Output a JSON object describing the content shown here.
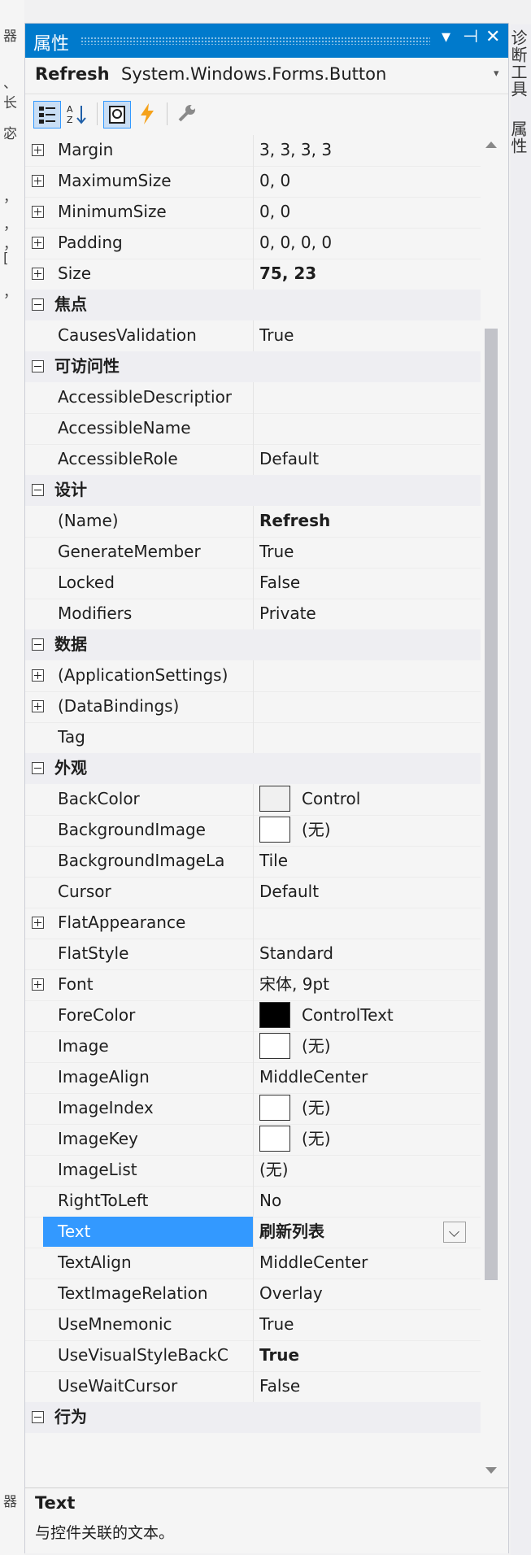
{
  "left_fragments": [
    "器",
    "、",
    "长",
    "宓",
    "，",
    "，",
    "，",
    "[",
    "，",
    "器"
  ],
  "right_tabs": [
    "诊断工具",
    "属性"
  ],
  "window": {
    "title": "属性",
    "dropdown_glyph": "▾",
    "pin_glyph": "⊣",
    "close_glyph": "✕"
  },
  "object": {
    "name": "Refresh",
    "type": "System.Windows.Forms.Button",
    "caret": "▾"
  },
  "toolbar": {
    "categorized_icon": "categorized-icon",
    "alphabetical_icon": "alphabetical-icon",
    "properties_icon": "properties-icon",
    "events_icon": "events-icon",
    "property_pages_icon": "property-pages-icon"
  },
  "rows": [
    {
      "kind": "prop",
      "expand": "plus",
      "name": "Margin",
      "value": "3, 3, 3, 3"
    },
    {
      "kind": "prop",
      "expand": "plus",
      "name": "MaximumSize",
      "value": "0, 0"
    },
    {
      "kind": "prop",
      "expand": "plus",
      "name": "MinimumSize",
      "value": "0, 0"
    },
    {
      "kind": "prop",
      "expand": "plus",
      "name": "Padding",
      "value": "0, 0, 0, 0"
    },
    {
      "kind": "prop",
      "expand": "plus",
      "name": "Size",
      "value": "75, 23",
      "bold": true
    },
    {
      "kind": "cat",
      "name": "焦点"
    },
    {
      "kind": "prop",
      "name": "CausesValidation",
      "value": "True"
    },
    {
      "kind": "cat",
      "name": "可访问性"
    },
    {
      "kind": "prop",
      "name": "AccessibleDescriptior",
      "value": ""
    },
    {
      "kind": "prop",
      "name": "AccessibleName",
      "value": ""
    },
    {
      "kind": "prop",
      "name": "AccessibleRole",
      "value": "Default"
    },
    {
      "kind": "cat",
      "name": "设计"
    },
    {
      "kind": "prop",
      "name": "(Name)",
      "value": "Refresh",
      "bold": true
    },
    {
      "kind": "prop",
      "name": "GenerateMember",
      "value": "True"
    },
    {
      "kind": "prop",
      "name": "Locked",
      "value": "False"
    },
    {
      "kind": "prop",
      "name": "Modifiers",
      "value": "Private"
    },
    {
      "kind": "cat",
      "name": "数据"
    },
    {
      "kind": "prop",
      "expand": "plus",
      "name": "(ApplicationSettings)",
      "value": ""
    },
    {
      "kind": "prop",
      "expand": "plus",
      "name": "(DataBindings)",
      "value": ""
    },
    {
      "kind": "prop",
      "name": "Tag",
      "value": ""
    },
    {
      "kind": "cat",
      "name": "外观"
    },
    {
      "kind": "prop",
      "name": "BackColor",
      "value": "Control",
      "swatch": "control"
    },
    {
      "kind": "prop",
      "name": "BackgroundImage",
      "value": "(无)",
      "swatch": "none"
    },
    {
      "kind": "prop",
      "name": "BackgroundImageLa",
      "value": "Tile"
    },
    {
      "kind": "prop",
      "name": "Cursor",
      "value": "Default"
    },
    {
      "kind": "prop",
      "expand": "plus",
      "name": "FlatAppearance",
      "value": ""
    },
    {
      "kind": "prop",
      "name": "FlatStyle",
      "value": "Standard"
    },
    {
      "kind": "prop",
      "expand": "plus",
      "name": "Font",
      "value": "宋体, 9pt"
    },
    {
      "kind": "prop",
      "name": "ForeColor",
      "value": "ControlText",
      "swatch": "black"
    },
    {
      "kind": "prop",
      "name": "Image",
      "value": "(无)",
      "swatch": "none"
    },
    {
      "kind": "prop",
      "name": "ImageAlign",
      "value": "MiddleCenter"
    },
    {
      "kind": "prop",
      "name": "ImageIndex",
      "value": "(无)",
      "swatch": "none"
    },
    {
      "kind": "prop",
      "name": "ImageKey",
      "value": "(无)",
      "swatch": "none"
    },
    {
      "kind": "prop",
      "name": "ImageList",
      "value": "(无)"
    },
    {
      "kind": "prop",
      "name": "RightToLeft",
      "value": "No"
    },
    {
      "kind": "prop",
      "name": "Text",
      "value": "刷新列表",
      "bold": true,
      "selected": true
    },
    {
      "kind": "prop",
      "name": "TextAlign",
      "value": "MiddleCenter"
    },
    {
      "kind": "prop",
      "name": "TextImageRelation",
      "value": "Overlay"
    },
    {
      "kind": "prop",
      "name": "UseMnemonic",
      "value": "True"
    },
    {
      "kind": "prop",
      "name": "UseVisualStyleBackC",
      "value": "True",
      "bold": true
    },
    {
      "kind": "prop",
      "name": "UseWaitCursor",
      "value": "False"
    },
    {
      "kind": "cat",
      "name": "行为"
    }
  ],
  "description": {
    "title": "Text",
    "text": "与控件关联的文本。"
  },
  "colors": {
    "accent": "#007acc",
    "selection": "#3399ff",
    "category_bg": "#eeeef2"
  }
}
